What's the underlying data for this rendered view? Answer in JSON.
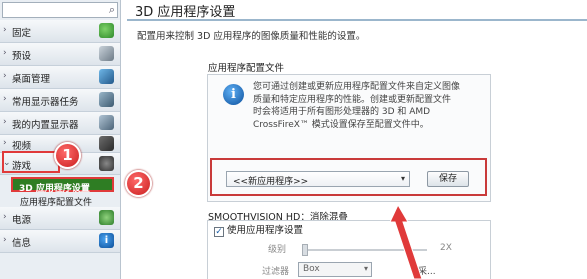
{
  "sidebar": {
    "search_icon_glyph": "⌕",
    "items": [
      {
        "label": "固定",
        "icon": "pin-icon"
      },
      {
        "label": "预设",
        "icon": "wrench-icon"
      },
      {
        "label": "桌面管理",
        "icon": "desktop-icon"
      },
      {
        "label": "常用显示器任务",
        "icon": "display-icon"
      },
      {
        "label": "我的内置显示器",
        "icon": "monitor-icon"
      },
      {
        "label": "视频",
        "icon": "video-icon"
      },
      {
        "label": "游戏",
        "icon": "gamepad-icon",
        "expanded": true
      },
      {
        "label": "电源",
        "icon": "power-icon"
      },
      {
        "label": "信息",
        "icon": "info-icon"
      }
    ],
    "sub_items": [
      "3D 应用程序设置",
      "应用程序配置文件"
    ],
    "chevron": "›",
    "chevron_expanded": "⌄"
  },
  "annotations": {
    "badge_1": "1",
    "badge_2": "2",
    "accent": "#e03a3a"
  },
  "main": {
    "title": "3D 应用程序设置",
    "description": "配置用来控制 3D 应用程序的图像质量和性能的设置。",
    "profile_section_label": "应用程序配置文件",
    "info_glyph": "i",
    "info_lines": [
      "您可通过创建或更新应用程序配置文件来自定义图像",
      "质量和特定应用程序的性能。创建或更新配置文件",
      "时会将适用于所有图形处理器的 3D 和 AMD",
      "CrossFireX™ 模式设置保存至配置文件中。"
    ],
    "app_select_value": "<<新应用程序>>",
    "dropdown_arrow": "▾",
    "save_label": "保存",
    "smoothvision_label": "SMOOTHVISION HD：消除混叠",
    "use_app_settings_label": "使用应用程序设置",
    "checkbox_mark": "✓",
    "level_label": "级别",
    "level_max": "2X",
    "filter_label": "过滤器",
    "filter_value": "Box",
    "right_more": "采..."
  }
}
